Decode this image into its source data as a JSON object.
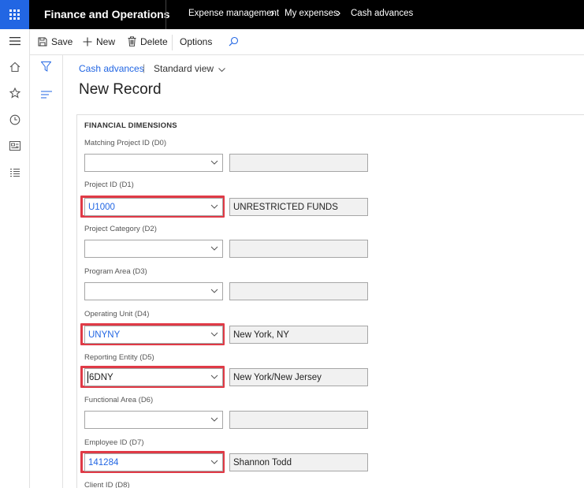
{
  "topbar": {
    "app_title": "Finance and Operations",
    "crumbs": [
      "Expense management",
      "My expenses",
      "Cash advances"
    ]
  },
  "actions": {
    "save": "Save",
    "new": "New",
    "delete": "Delete",
    "options": "Options"
  },
  "breadcrumb": {
    "link": "Cash advances",
    "separator": "|",
    "view": "Standard view"
  },
  "page_title": "New Record",
  "section_title": "FINANCIAL DIMENSIONS",
  "fields": [
    {
      "label": "Matching Project ID (D0)",
      "value": "",
      "description": ""
    },
    {
      "label": "Project ID (D1)",
      "value": "U1000",
      "description": "UNRESTRICTED FUNDS"
    },
    {
      "label": "Project Category (D2)",
      "value": "",
      "description": ""
    },
    {
      "label": "Program Area (D3)",
      "value": "",
      "description": ""
    },
    {
      "label": "Operating Unit (D4)",
      "value": "UNYNY",
      "description": "New York, NY"
    },
    {
      "label": "Reporting Entity (D5)",
      "value": "6DNY",
      "description": "New York/New Jersey"
    },
    {
      "label": "Functional Area (D6)",
      "value": "",
      "description": ""
    },
    {
      "label": "Employee ID (D7)",
      "value": "141284",
      "description": "Shannon Todd"
    },
    {
      "label": "Client ID (D8)",
      "value": "",
      "description": ""
    }
  ],
  "colors": {
    "accent": "#2266e3",
    "highlight": "#e03a46",
    "topbar": "#000000"
  }
}
